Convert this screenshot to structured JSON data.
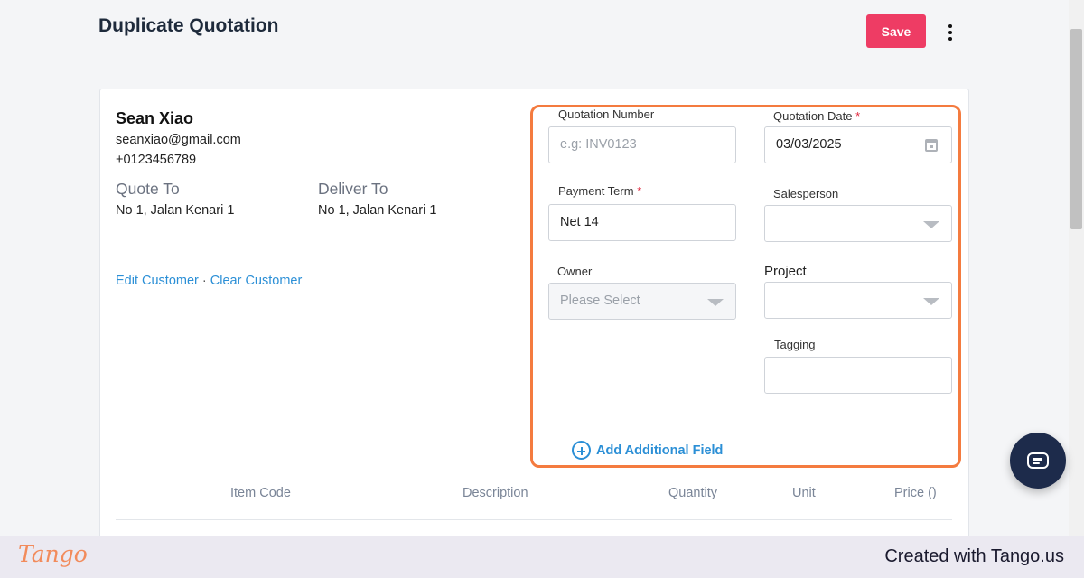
{
  "header": {
    "title": "Duplicate Quotation",
    "save_label": "Save",
    "more_icon": "more-vertical-icon"
  },
  "customer": {
    "name": "Sean Xiao",
    "email": "seanxiao@gmail.com",
    "phone": "+0123456789",
    "quote_to_label": "Quote To",
    "quote_to_address": "No 1, Jalan Kenari 1",
    "deliver_to_label": "Deliver To",
    "deliver_to_address": "No 1, Jalan Kenari 1",
    "edit_label": "Edit Customer",
    "separator": "·",
    "clear_label": "Clear Customer"
  },
  "form": {
    "quotation_number": {
      "label": "Quotation Number",
      "value": "",
      "placeholder": "e.g: INV0123"
    },
    "quotation_date": {
      "label": "Quotation Date",
      "required_mark": "*",
      "value": "03/03/2025"
    },
    "payment_term": {
      "label": "Payment Term",
      "required_mark": "*",
      "value": "Net 14"
    },
    "salesperson": {
      "label": "Salesperson",
      "value": ""
    },
    "owner": {
      "label": "Owner",
      "placeholder": "Please Select"
    },
    "project": {
      "label": "Project",
      "value": ""
    },
    "tagging": {
      "label": "Tagging",
      "value": ""
    },
    "add_field_label": "Add Additional Field"
  },
  "table": {
    "columns": [
      "Item Code",
      "Description",
      "Quantity",
      "Unit",
      "Price ()"
    ]
  },
  "colors": {
    "save_button": "#ee3c64",
    "highlight_border": "#f47b3f",
    "link": "#2b8fd6",
    "chat_button": "#1d2b4b"
  },
  "footer": {
    "logo": "Tango",
    "credit": "Created with Tango.us"
  }
}
